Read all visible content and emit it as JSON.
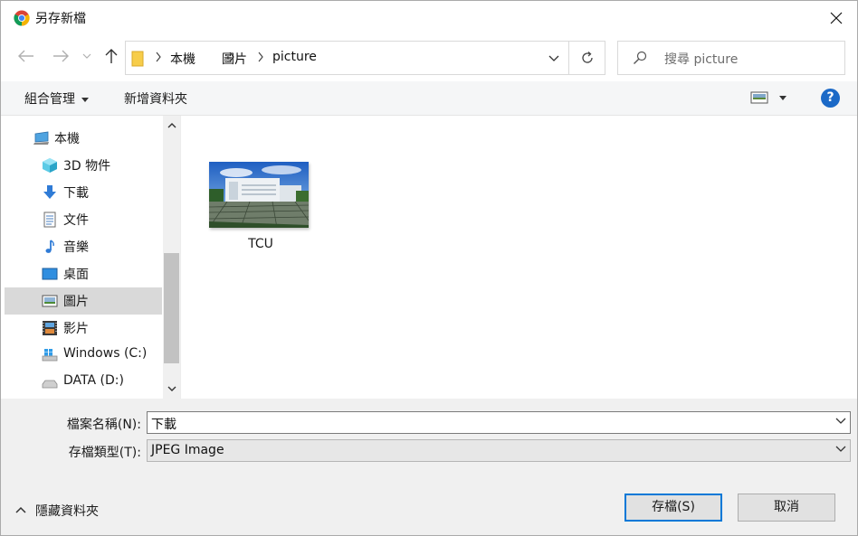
{
  "window": {
    "title": "另存新檔"
  },
  "address": {
    "crumbs": [
      "本機",
      "圖片",
      "picture"
    ]
  },
  "search": {
    "placeholder": "搜尋 picture"
  },
  "toolbar": {
    "organize": "組合管理",
    "new_folder": "新增資料夾",
    "help": "?"
  },
  "nav": {
    "items": [
      {
        "label": "本機",
        "icon": "computer-icon"
      },
      {
        "label": "3D 物件",
        "icon": "cube-icon"
      },
      {
        "label": "下載",
        "icon": "download-icon"
      },
      {
        "label": "文件",
        "icon": "document-icon"
      },
      {
        "label": "音樂",
        "icon": "music-icon"
      },
      {
        "label": "桌面",
        "icon": "desktop-icon"
      },
      {
        "label": "圖片",
        "icon": "pictures-icon"
      },
      {
        "label": "影片",
        "icon": "video-icon"
      },
      {
        "label": "Windows (C:)",
        "icon": "windows-drive-icon"
      },
      {
        "label": "DATA (D:)",
        "icon": "drive-icon"
      }
    ],
    "selected_index": 6
  },
  "files": [
    {
      "name": "TCU"
    }
  ],
  "form": {
    "filename_label": "檔案名稱(N):",
    "filename_value": "下載",
    "filetype_label": "存檔類型(T):",
    "filetype_value": "JPEG Image"
  },
  "footer": {
    "hide_folders": "隱藏資料夾",
    "save": "存檔(S)",
    "cancel": "取消"
  },
  "colors": {
    "accent": "#0078d7",
    "selected": "#d9d9d9",
    "panel": "#f0f0f0"
  }
}
